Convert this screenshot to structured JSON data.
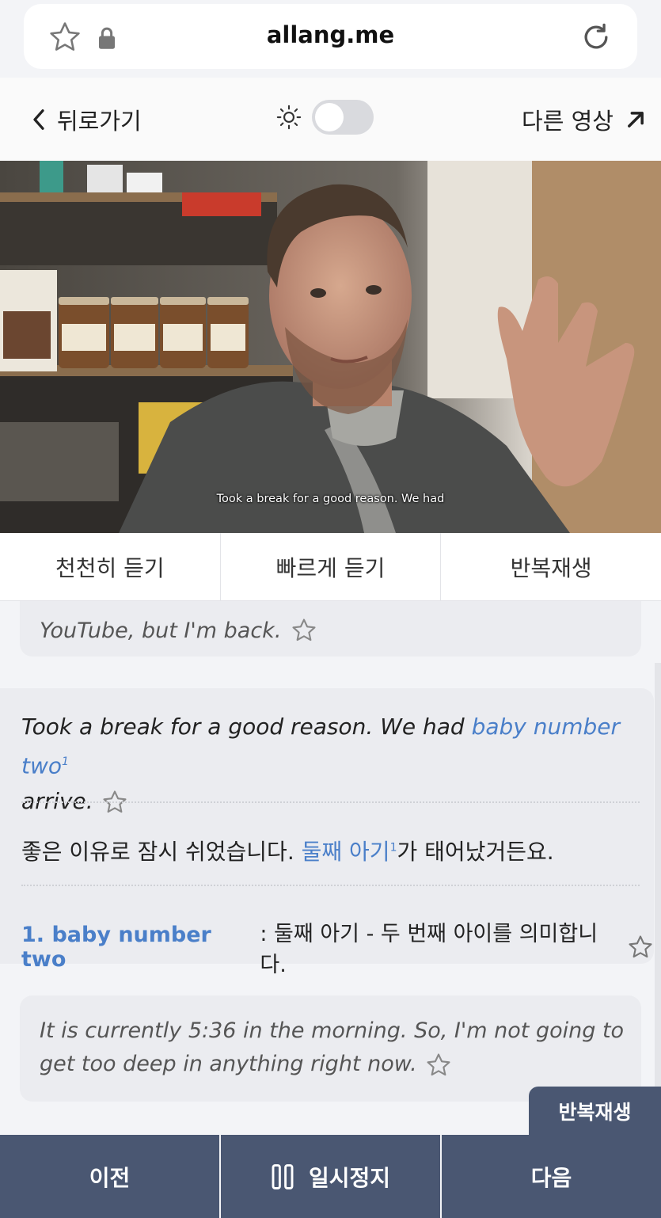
{
  "browser": {
    "domain": "allang.me"
  },
  "header": {
    "back_label": "뒤로가기",
    "other_video_label": "다른 영상",
    "dark_mode_on": false
  },
  "video": {
    "caption": "Took a break for a good reason. We had"
  },
  "tabs": [
    {
      "label": "천천히 듣기"
    },
    {
      "label": "빠르게 듣기"
    },
    {
      "label": "반복재생"
    }
  ],
  "transcript": {
    "previous": {
      "en": "YouTube, but I'm back."
    },
    "active": {
      "en_before": "Took a break for a good reason. We had ",
      "en_highlight": "baby number two",
      "en_marker": "1",
      "en_after": "arrive.",
      "ko_before": "좋은 이유로 잠시 쉬었습니다. ",
      "ko_highlight": "둘째 아기",
      "ko_marker": "1",
      "ko_after": "가 태어났거든요.",
      "note_term": "1. baby number two",
      "note_text": ": 둘째 아기 - 두 번째 아이를 의미합니다."
    },
    "next": {
      "en": "It is currently 5:36 in the morning. So, I'm not going to get too deep in anything right now."
    }
  },
  "repeat_tag": "반복재생",
  "controls": {
    "prev_label": "이전",
    "pause_label": "일시정지",
    "next_label": "다음"
  },
  "colors": {
    "accent": "#4a7fc9",
    "control_bar": "#4a5772",
    "background": "#f3f4f7"
  }
}
